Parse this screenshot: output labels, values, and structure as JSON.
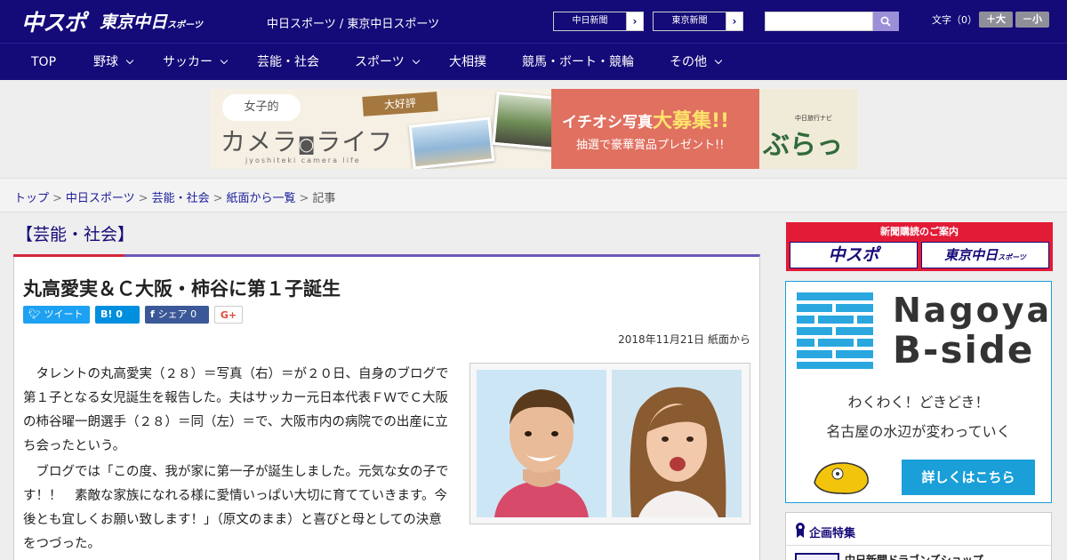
{
  "header": {
    "logo_main": "中スポ",
    "logo_tokyo": "東京中日",
    "logo_tokyo_small": "スポーツ",
    "site_name": "中日スポーツ / 東京中日スポーツ",
    "btn_chunichi": "中日新聞",
    "btn_tokyo": "東京新聞",
    "arrow": "›",
    "fontsize_label": "文字（0）",
    "font_big": "＋大",
    "font_small": "－小"
  },
  "nav": {
    "items": [
      {
        "label": "TOP",
        "dropdown": false
      },
      {
        "label": "野球",
        "dropdown": true
      },
      {
        "label": "サッカー",
        "dropdown": true
      },
      {
        "label": "芸能・社会",
        "dropdown": false
      },
      {
        "label": "スポーツ",
        "dropdown": true
      },
      {
        "label": "大相撲",
        "dropdown": false
      },
      {
        "label": "競馬・ボート・競輪",
        "dropdown": false
      },
      {
        "label": "その他",
        "dropdown": true
      }
    ]
  },
  "banner": {
    "joshi": "女子的",
    "title": "カメラ",
    "title2": "ライフ",
    "sub": "jyoshiteki camera life",
    "daikohyo": "大好評",
    "ichioshi": "イチオシ写真",
    "daiboshu": "大募集!!",
    "present": "抽選で豪華賞品プレゼント!!",
    "navi": "中日旅行ナビ",
    "bura": "ぶらっ人"
  },
  "breadcrumb": {
    "items": [
      "トップ",
      "中日スポーツ",
      "芸能・社会",
      "紙面から一覧"
    ],
    "current": "記事",
    "sep": ">"
  },
  "article": {
    "category": "【芸能・社会】",
    "title": "丸高愛実＆Ｃ大阪・柿谷に第１子誕生",
    "share": {
      "tweet": "ツイート",
      "hatena": "B! 0",
      "facebook": "シェア 0",
      "gplus": "G+"
    },
    "date": "2018年11月21日 紙面から",
    "paragraphs": [
      "　タレントの丸高愛実（２８）＝写真（右）＝が２０日、自身のブログで第１子となる女児誕生を報告した。夫はサッカー元日本代表ＦＷでＣ大阪の柿谷曜一朗選手（２８）＝同（左）＝で、大阪市内の病院での出産に立ち会ったという。",
      "　ブログでは「この度、我が家に第一子が誕生しました。元気な女の子です！！　素敵な家族になれる様に愛情いっぱい大切に育てていきます。今後とも宜しくお願い致します！」（原文のまま）と喜びと母としての決意をつづった。"
    ]
  },
  "sidebar": {
    "subscription_title": "新聞購読のご案内",
    "sub_chuspo": "中スポ",
    "sub_tokyo": "東京中日",
    "sub_tokyo_small": "スポーツ",
    "bside_title1": "Nagoya",
    "bside_title2": "B-side",
    "bside_text1": "わくわく！どきどき！",
    "bside_text2": "名古屋の水辺が変わっていく",
    "bside_button": "詳しくはこちら",
    "feature_title": "企画特集",
    "feature_item": "中日新聞ドラゴンズショップ"
  },
  "colors": {
    "brand_navy": "#140a78",
    "accent_red": "#d2263b",
    "bside_blue": "#1a9fd8"
  }
}
